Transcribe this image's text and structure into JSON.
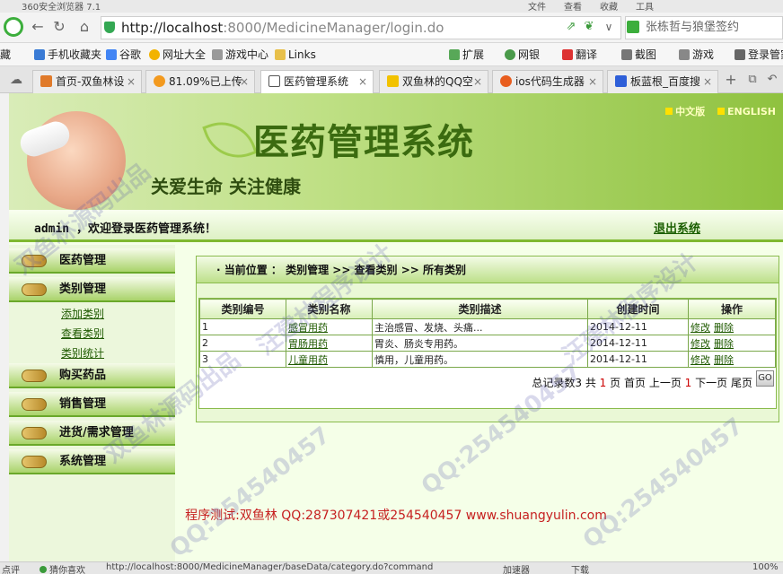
{
  "browser": {
    "title": "360安全浏览器 7.1",
    "menu": [
      "文件",
      "查看",
      "收藏",
      "工具"
    ],
    "url_host": "http://localhost",
    "url_rest": ":8000/MedicineManager/login.do",
    "search_text": "张栋哲与狼堡签约",
    "bookmarks": [
      "藏",
      "手机收藏夹",
      "谷歌",
      "网址大全",
      "游戏中心",
      "Links",
      "扩展",
      "网银",
      "翻译",
      "截图",
      "游戏",
      "登录管家"
    ],
    "tabs": [
      {
        "label": "首页-双鱼林设",
        "active": false
      },
      {
        "label": "81.09%已上传",
        "active": false
      },
      {
        "label": "医药管理系统",
        "active": true
      },
      {
        "label": "双鱼林的QQ空",
        "active": false
      },
      {
        "label": "ios代码生成器",
        "active": false
      },
      {
        "label": "板蓝根_百度搜",
        "active": false
      }
    ]
  },
  "banner": {
    "title": "医药管理系统",
    "slogan": "关爱生命  关注健康",
    "lang_cn": "中文版",
    "lang_en": "ENGLISH"
  },
  "welcome": {
    "text": "admin ，欢迎登录医药管理系统！",
    "logout": "退出系统"
  },
  "sidebar": {
    "menus": [
      {
        "label": "医药管理"
      },
      {
        "label": "类别管理"
      },
      {
        "label": "购买药品"
      },
      {
        "label": "销售管理"
      },
      {
        "label": "进货/需求管理"
      },
      {
        "label": "系统管理"
      }
    ],
    "submenu": [
      "添加类别",
      "查看类别",
      "类别统计"
    ]
  },
  "content": {
    "breadcrumb": "· 当前位置 ： 类别管理 >> 查看类别 >> 所有类别",
    "columns": [
      "类别编号",
      "类别名称",
      "类别描述",
      "创建时间",
      "操作"
    ],
    "rows": [
      {
        "id": "1",
        "name": "感冒用药",
        "desc": "主治感冒、发烧、头痛...",
        "date": "2014-12-11"
      },
      {
        "id": "2",
        "name": "胃肠用药",
        "desc": "胃炎、肠炎专用药。",
        "date": "2014-12-11"
      },
      {
        "id": "3",
        "name": "儿童用药",
        "desc": "慎用，儿童用药。",
        "date": "2014-12-11"
      }
    ],
    "edit_label": "修改",
    "delete_label": "删除",
    "pager": {
      "total_prefix": "总记录数3 共",
      "pages": "1",
      "page_word": "页",
      "first": "首页",
      "prev": "上一页",
      "current": "1",
      "next": "下一页",
      "last": "尾页",
      "go": "GO"
    }
  },
  "footer": "程序测试:双鱼林 QQ:287307421或254540457 www.shuangyulin.com",
  "statusbar": {
    "left": "点评",
    "guess": "猜你喜欢",
    "url": "http://localhost:8000/MedicineManager/baseData/category.do?command",
    "accel": "加速器",
    "download": "下载",
    "zoom": "100%"
  },
  "watermarks": [
    "双鱼林源码出品",
    "汪建林程序设计",
    "QQ:254540457"
  ]
}
